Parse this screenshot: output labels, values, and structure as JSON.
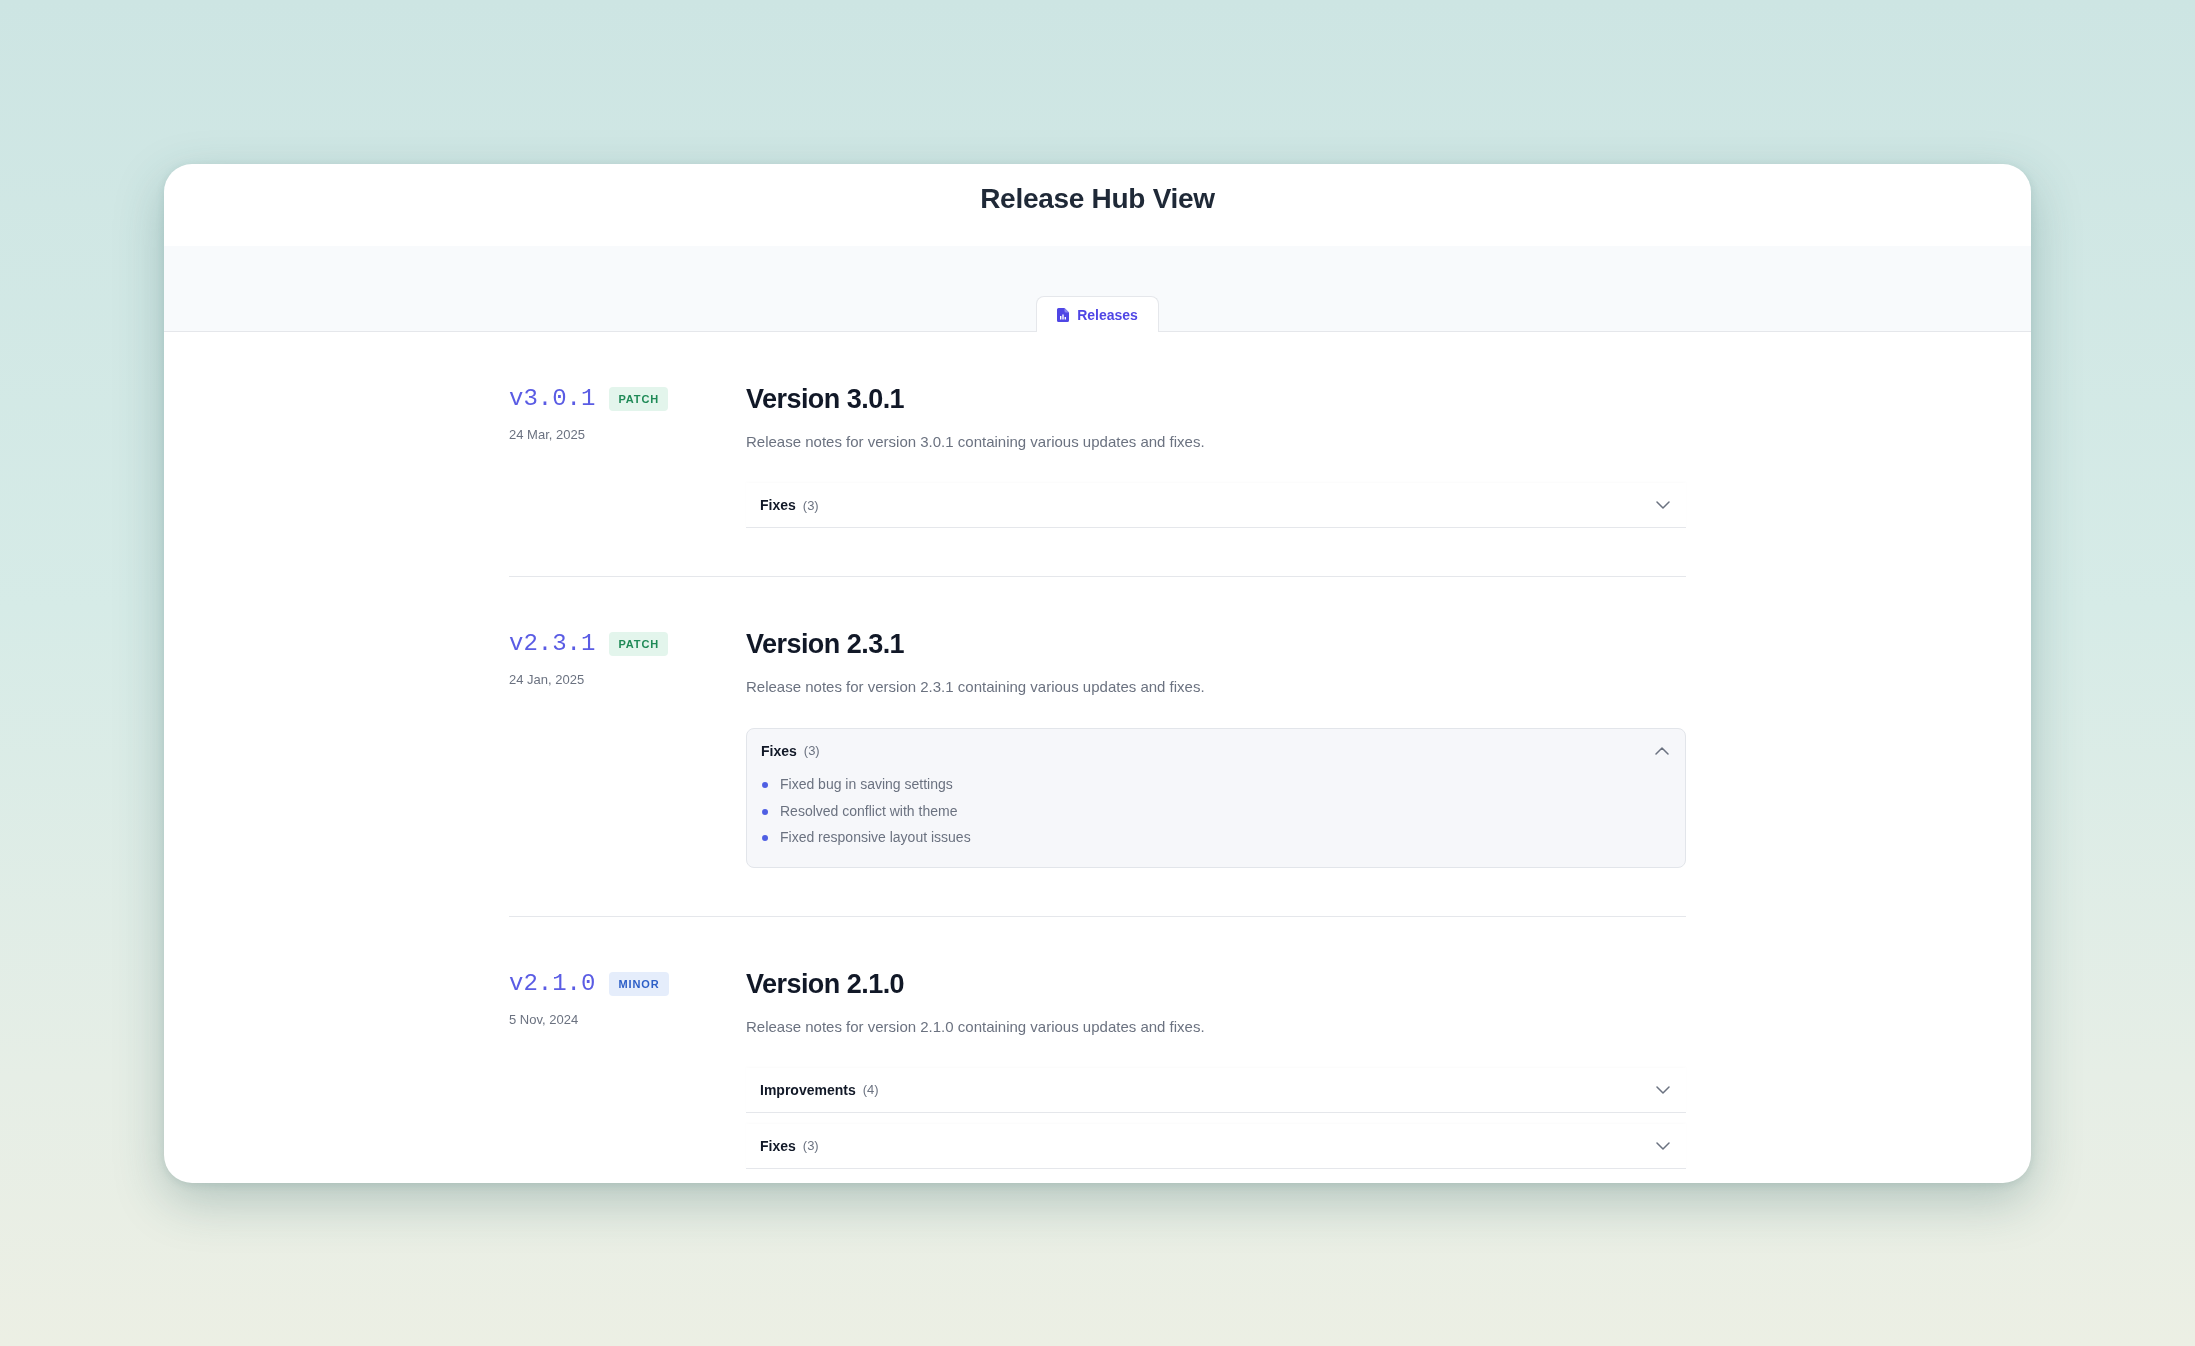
{
  "title": "Release Hub View",
  "tabs": [
    {
      "label": "Releases",
      "selected": true
    }
  ],
  "releases": [
    {
      "version": "v3.0.1",
      "badge": {
        "label": "PATCH",
        "kind": "patch"
      },
      "date": "24 Mar, 2025",
      "heading": "Version 3.0.1",
      "description": "Release notes for version 3.0.1 containing various updates and fixes.",
      "sections": [
        {
          "title": "Fixes",
          "count": "(3)",
          "expanded": false
        }
      ]
    },
    {
      "version": "v2.3.1",
      "badge": {
        "label": "PATCH",
        "kind": "patch"
      },
      "date": "24 Jan, 2025",
      "heading": "Version 2.3.1",
      "description": "Release notes for version 2.3.1 containing various updates and fixes.",
      "sections": [
        {
          "title": "Fixes",
          "count": "(3)",
          "expanded": true,
          "items": [
            "Fixed bug in saving settings",
            "Resolved conflict with theme",
            "Fixed responsive layout issues"
          ]
        }
      ]
    },
    {
      "version": "v2.1.0",
      "badge": {
        "label": "MINOR",
        "kind": "minor"
      },
      "date": "5 Nov, 2024",
      "heading": "Version 2.1.0",
      "description": "Release notes for version 2.1.0 containing various updates and fixes.",
      "sections": [
        {
          "title": "Improvements",
          "count": "(4)",
          "expanded": false
        },
        {
          "title": "Fixes",
          "count": "(3)",
          "expanded": false
        }
      ]
    }
  ]
}
